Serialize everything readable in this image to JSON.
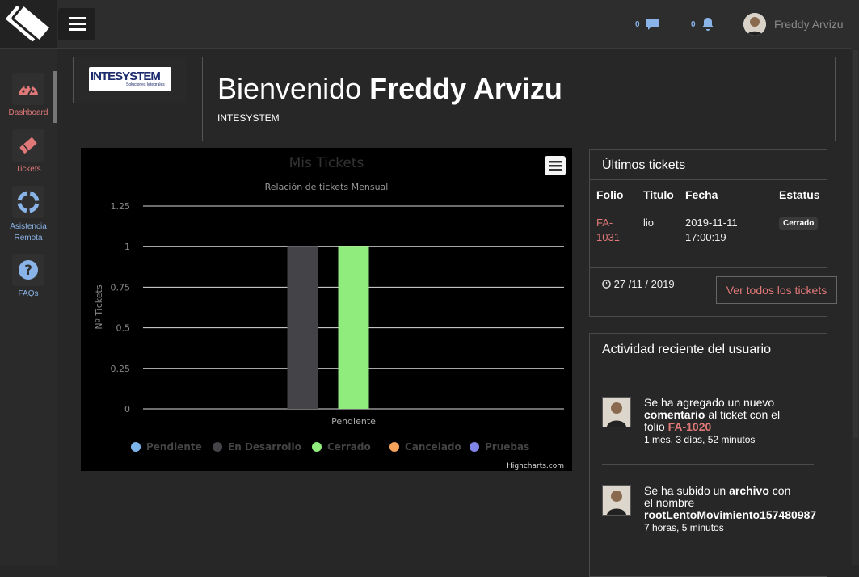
{
  "header": {
    "messages_count": "0",
    "notifications_count": "0",
    "user_name": "Freddy Arvizu"
  },
  "sidebar": {
    "items": [
      {
        "label": "Dashboard",
        "icon": "dashboard-icon"
      },
      {
        "label": "Tickets",
        "icon": "ticket-icon"
      },
      {
        "label": "Asistencia Remota",
        "icon": "life-ring-icon"
      },
      {
        "label": "FAQs",
        "icon": "question-icon"
      }
    ]
  },
  "welcome": {
    "greeting": "Bienvenido",
    "name": "Freddy Arvizu",
    "company": "INTESYSTEM",
    "logo_text": "INTESYSTEM",
    "logo_tagline": "Soluciones Integrales"
  },
  "chart_data": {
    "type": "bar",
    "title": "Mis Tickets",
    "subtitle": "Relación de tickets Mensual",
    "ylabel": "Nº Tickets",
    "categories": [
      "Pendiente"
    ],
    "ylim": [
      0,
      1.25
    ],
    "yticks": [
      "0",
      "0.25",
      "0.5",
      "0.75",
      "1",
      "1.25"
    ],
    "series": [
      {
        "name": "Pendiente",
        "values": [
          0
        ],
        "color": "#7cb5ec"
      },
      {
        "name": "En Desarrollo",
        "values": [
          1
        ],
        "color": "#434348"
      },
      {
        "name": "Cerrado",
        "values": [
          1
        ],
        "color": "#90ed7d"
      },
      {
        "name": "Cancelado",
        "values": [
          0
        ],
        "color": "#f7a35c"
      },
      {
        "name": "Pruebas",
        "values": [
          0
        ],
        "color": "#8085e9"
      }
    ],
    "credit": "Highcharts.com",
    "legend": "bottom",
    "grid": true
  },
  "tickets": {
    "title": "Últimos tickets",
    "columns": [
      "Folio",
      "Titulo",
      "Fecha",
      "Estatus"
    ],
    "rows": [
      {
        "folio_1": "FA-",
        "folio_2": "1031",
        "titulo": "lio",
        "fecha_1": "2019-11-11",
        "fecha_2": "17:00:19",
        "estatus": "Cerrado"
      }
    ],
    "date": "27 /11 / 2019",
    "view_all": "Ver todos los tickets"
  },
  "activity": {
    "title": "Actividad reciente del usuario",
    "items": [
      {
        "t1": "Se ha agregado un nuevo",
        "t2": "comentario",
        "t3": " al ticket con el",
        "t4": "folio ",
        "t5": "FA-1020",
        "time": "1 mes, 3 días, 52 minutos"
      },
      {
        "t1": "Se ha subido un ",
        "t2": "archivo",
        "t3": " con",
        "t4": "el nombre",
        "t5": "rootLentoMovimiento157480987",
        "time": "7 horas, 5 minutos"
      }
    ]
  }
}
